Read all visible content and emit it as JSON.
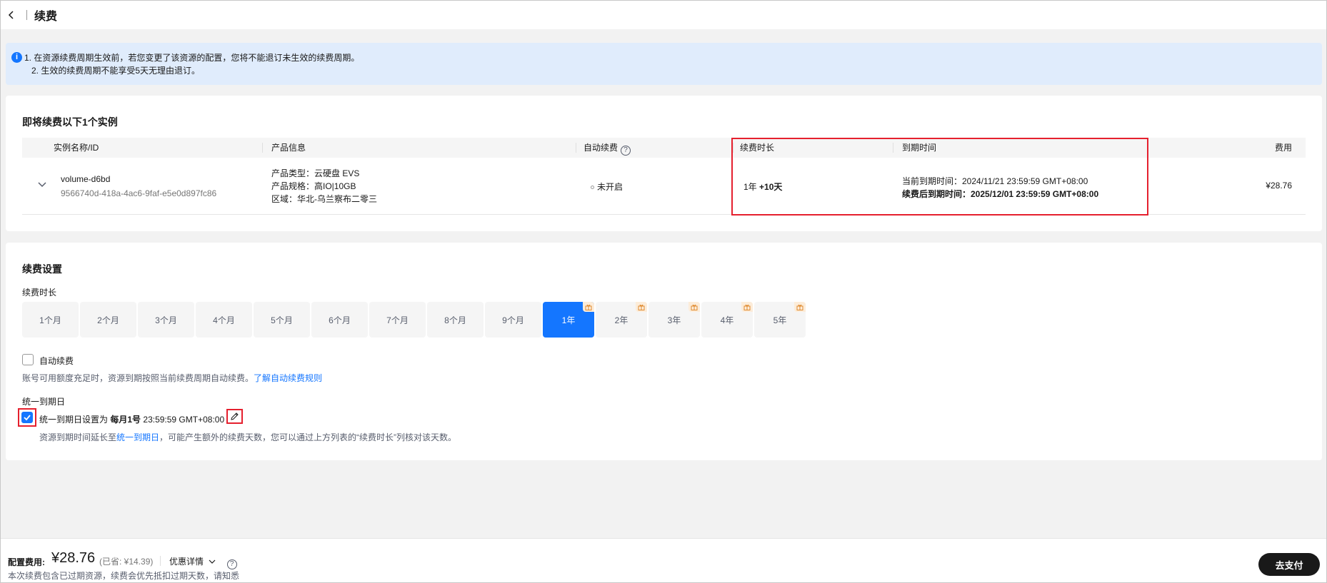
{
  "header": {
    "title": "续费"
  },
  "notice": {
    "lines": [
      "1. 在资源续费周期生效前，若您变更了该资源的配置，您将不能退订未生效的续费周期。",
      "2. 生效的续费周期不能享受5天无理由退订。"
    ]
  },
  "instances": {
    "title": "即将续费以下1个实例",
    "columns": {
      "name": "实例名称/ID",
      "product": "产品信息",
      "auto_renew": "自动续费",
      "duration": "续费时长",
      "expire": "到期时间",
      "fee": "费用"
    },
    "rows": [
      {
        "name": "volume-d6bd",
        "id": "9566740d-418a-4ac6-9faf-e5e0d897fc86",
        "product_type": "产品类型：云硬盘 EVS",
        "product_spec": "产品规格：高IO|10GB",
        "region": "区域：华北-乌兰察布二零三",
        "auto_renew": "未开启",
        "duration_base": "1年",
        "duration_extra": "+10天",
        "current_expire": "当前到期时间：2024/11/21 23:59:59 GMT+08:00",
        "new_expire": "续费后到期时间：2025/12/01 23:59:59 GMT+08:00",
        "fee": "¥28.76"
      }
    ]
  },
  "settings": {
    "title": "续费设置",
    "duration_label": "续费时长",
    "months": [
      "1个月",
      "2个月",
      "3个月",
      "4个月",
      "5个月",
      "6个月",
      "7个月",
      "8个月",
      "9个月"
    ],
    "years": [
      "1年",
      "2年",
      "3年",
      "4年",
      "5年"
    ],
    "selected": "1年",
    "auto_renew_label": "自动续费",
    "auto_renew_desc": "账号可用额度充足时，资源到期按照当前续费周期自动续费。",
    "auto_renew_link": "了解自动续费规则",
    "unified_label": "统一到期日",
    "unified_text_prefix": "统一到期日设置为",
    "unified_day": "每月1号",
    "unified_time": "23:59:59 GMT+08:00",
    "unified_desc_prefix": "资源到期时间延长至",
    "unified_desc_link": "统一到期日",
    "unified_desc_suffix": "，可能产生额外的续费天数，您可以通过上方列表的“续费时长”列核对该天数。"
  },
  "footer": {
    "fee_label": "配置费用:",
    "fee_amount": "¥28.76",
    "fee_saved": "(已省: ¥14.39)",
    "discount_label": "优惠详情",
    "note": "本次续费包含已过期资源，续费会优先抵扣过期天数，请知悉",
    "pay_label": "去支付"
  },
  "colors": {
    "accent": "#1476ff",
    "highlight": "#e5202e",
    "notice_bg": "#e0ecfc"
  }
}
